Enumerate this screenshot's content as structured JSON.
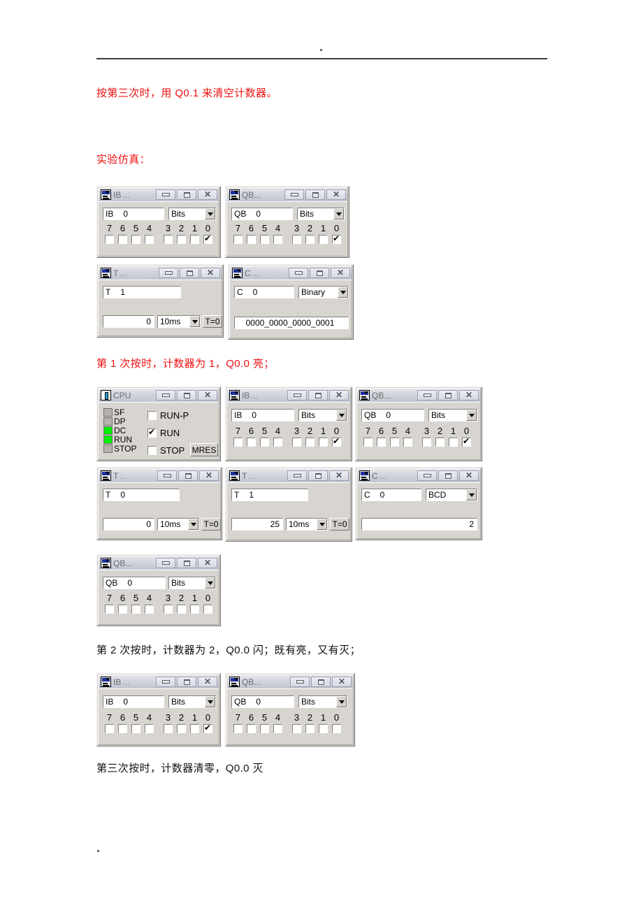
{
  "document": {
    "header_mark": ".",
    "footer_mark": "."
  },
  "paragraphs": [
    {
      "text": "按第三次时，用 Q0.1 来清空计数器。",
      "color": "red"
    },
    {
      "text": "实验仿真：",
      "color": "red"
    },
    {
      "text": "第 1 次按时，计数器为 1，Q0.0 亮；",
      "color": "red"
    },
    {
      "text": "第 2 次按时，计数器为 2，Q0.0 闪；既有亮，又有灭；",
      "color": "black"
    },
    {
      "text": "第三次按时，计数器清零，Q0.0 灭",
      "color": "black"
    }
  ],
  "colors": {
    "red": "#ee1111",
    "black": "#111111",
    "led_on": "#00ee00",
    "led_off": "#b5b2ad"
  },
  "window_buttons": {
    "minimize": "minimize",
    "maximize": "maximize",
    "close": "✕",
    "ellipsis": "..."
  },
  "groups": [
    {
      "name": "group-1-initial-state",
      "windows": [
        {
          "id": "g1-ib",
          "kind": "bits",
          "title": "IB",
          "addr_prefix": "IB",
          "addr_value": "0",
          "format": "Bits",
          "bit_labels": [
            "7",
            "6",
            "5",
            "4",
            "3",
            "2",
            "1",
            "0"
          ],
          "bits": [
            false,
            false,
            false,
            false,
            false,
            false,
            false,
            true
          ]
        },
        {
          "id": "g1-qb",
          "kind": "bits",
          "title": "QB...",
          "addr_prefix": "QB",
          "addr_value": "0",
          "format": "Bits",
          "bit_labels": [
            "7",
            "6",
            "5",
            "4",
            "3",
            "2",
            "1",
            "0"
          ],
          "bits": [
            false,
            false,
            false,
            false,
            false,
            false,
            false,
            true
          ]
        },
        {
          "id": "g1-t1",
          "kind": "timer",
          "title": "T",
          "addr_prefix": "T",
          "addr_value": "1",
          "value": "0",
          "timebase": "10ms",
          "reset_label": "T=0"
        },
        {
          "id": "g1-c0",
          "kind": "counter",
          "title": "C",
          "addr_prefix": "C",
          "addr_value": "0",
          "format": "Binary",
          "value": "0000_0000_0000_0001"
        }
      ]
    },
    {
      "name": "group-2-first-press",
      "windows": [
        {
          "id": "g2-cpu",
          "kind": "cpu",
          "title": "CPU",
          "leds": [
            {
              "label": "SF",
              "on": false
            },
            {
              "label": "DP",
              "on": false
            },
            {
              "label": "DC",
              "on": true
            },
            {
              "label": "RUN",
              "on": true
            },
            {
              "label": "STOP",
              "on": false
            }
          ],
          "modes": [
            {
              "label": "RUN-P",
              "checked": false
            },
            {
              "label": "RUN",
              "checked": true
            },
            {
              "label": "STOP",
              "checked": false
            }
          ],
          "mres_label": "MRES"
        },
        {
          "id": "g2-ib",
          "kind": "bits",
          "title": "IB",
          "addr_prefix": "IB",
          "addr_value": "0",
          "format": "Bits",
          "bit_labels": [
            "7",
            "6",
            "5",
            "4",
            "3",
            "2",
            "1",
            "0"
          ],
          "bits": [
            false,
            false,
            false,
            false,
            false,
            false,
            false,
            true
          ]
        },
        {
          "id": "g2-qb",
          "kind": "bits",
          "title": "QB...",
          "addr_prefix": "QB",
          "addr_value": "0",
          "format": "Bits",
          "bit_labels": [
            "7",
            "6",
            "5",
            "4",
            "3",
            "2",
            "1",
            "0"
          ],
          "bits": [
            false,
            false,
            false,
            false,
            false,
            false,
            false,
            true
          ]
        },
        {
          "id": "g2-t0",
          "kind": "timer",
          "title": "T",
          "addr_prefix": "T",
          "addr_value": "0",
          "value": "0",
          "timebase": "10ms",
          "reset_label": "T=0"
        },
        {
          "id": "g2-t1",
          "kind": "timer",
          "title": "T",
          "addr_prefix": "T",
          "addr_value": "1",
          "value": "25",
          "timebase": "10ms",
          "reset_label": "T=0"
        },
        {
          "id": "g2-c0",
          "kind": "counter",
          "title": "C",
          "addr_prefix": "C",
          "addr_value": "0",
          "format": "BCD",
          "value": "2"
        }
      ]
    },
    {
      "name": "group-3-output-off",
      "windows": [
        {
          "id": "g3-qb",
          "kind": "bits",
          "title": "QB...",
          "addr_prefix": "QB",
          "addr_value": "0",
          "format": "Bits",
          "bit_labels": [
            "7",
            "6",
            "5",
            "4",
            "3",
            "2",
            "1",
            "0"
          ],
          "bits": [
            false,
            false,
            false,
            false,
            false,
            false,
            false,
            false
          ]
        }
      ]
    },
    {
      "name": "group-4-third-press",
      "windows": [
        {
          "id": "g4-ib",
          "kind": "bits",
          "title": "IB",
          "addr_prefix": "IB",
          "addr_value": "0",
          "format": "Bits",
          "bit_labels": [
            "7",
            "6",
            "5",
            "4",
            "3",
            "2",
            "1",
            "0"
          ],
          "bits": [
            false,
            false,
            false,
            false,
            false,
            false,
            false,
            true
          ]
        },
        {
          "id": "g4-qb",
          "kind": "bits",
          "title": "QB...",
          "addr_prefix": "QB",
          "addr_value": "0",
          "format": "Bits",
          "bit_labels": [
            "7",
            "6",
            "5",
            "4",
            "3",
            "2",
            "1",
            "0"
          ],
          "bits": [
            false,
            false,
            false,
            false,
            false,
            false,
            false,
            false
          ]
        }
      ]
    }
  ]
}
